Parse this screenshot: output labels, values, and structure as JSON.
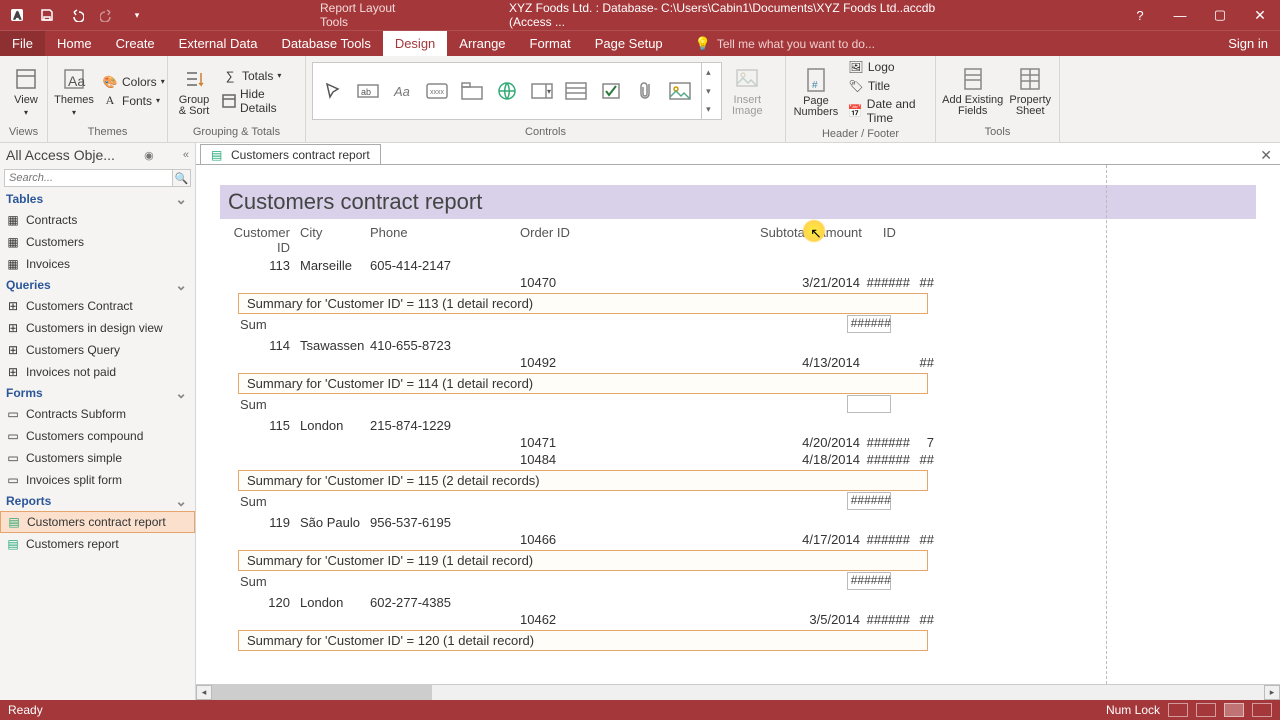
{
  "titlebar": {
    "tools_label": "Report Layout Tools",
    "doc_title": "XYZ Foods Ltd. : Database- C:\\Users\\Cabin1\\Documents\\XYZ Foods Ltd..accdb (Access ..."
  },
  "menu": {
    "file": "File",
    "home": "Home",
    "create": "Create",
    "external": "External Data",
    "dbtools": "Database Tools",
    "design": "Design",
    "arrange": "Arrange",
    "format": "Format",
    "pagesetup": "Page Setup",
    "tellme": "Tell me what you want to do...",
    "signin": "Sign in"
  },
  "ribbon": {
    "views_lbl": "Views",
    "view": "View",
    "themes_lbl": "Themes",
    "themes": "Themes",
    "colors": "Colors",
    "fonts": "Fonts",
    "group_sort": "Group\n& Sort",
    "totals": "Totals",
    "hide_details": "Hide Details",
    "grouping_lbl": "Grouping & Totals",
    "controls_lbl": "Controls",
    "insert_image": "Insert\nImage",
    "page_numbers": "Page\nNumbers",
    "logo": "Logo",
    "title": "Title",
    "datetime": "Date and Time",
    "headerfooter_lbl": "Header / Footer",
    "add_existing": "Add Existing\nFields",
    "property_sheet": "Property\nSheet",
    "tools_lbl": "Tools"
  },
  "nav": {
    "header": "All Access Obje...",
    "search_placeholder": "Search...",
    "tables": "Tables",
    "tables_items": [
      "Contracts",
      "Customers",
      "Invoices"
    ],
    "queries": "Queries",
    "queries_items": [
      "Customers Contract",
      "Customers in design view",
      "Customers Query",
      "Invoices not paid"
    ],
    "forms": "Forms",
    "forms_items": [
      "Contracts Subform",
      "Customers compound",
      "Customers simple",
      "Invoices split form"
    ],
    "reports": "Reports",
    "reports_items": [
      "Customers contract report",
      "Customers report"
    ]
  },
  "doc": {
    "tab_title": "Customers contract report"
  },
  "report": {
    "title": "Customers contract report",
    "cols": {
      "custid": "Customer ID",
      "city": "City",
      "phone": "Phone",
      "orderid": "Order ID",
      "date_amount": "Subtotals Amount",
      "amount": "Amount",
      "id": "ID"
    },
    "r113": {
      "cust": "113",
      "city": "Marseille",
      "phone": "605-414-2147",
      "order": "10470",
      "date": "3/21/2014",
      "amount": "######",
      "id": "##",
      "summary": "Summary for 'Customer ID' =  113 (1 detail record)",
      "sum": "Sum",
      "sumval": "######"
    },
    "r114": {
      "cust": "114",
      "city": "Tsawassen",
      "phone": "410-655-8723",
      "order": "10492",
      "date": "4/13/2014",
      "amount": "",
      "id": "##",
      "summary": "Summary for 'Customer ID' =  114 (1 detail record)",
      "sum": "Sum",
      "sumval": ""
    },
    "r115": {
      "cust": "115",
      "city": "London",
      "phone": "215-874-1229",
      "o1": "10471",
      "d1": "4/20/2014",
      "a1": "######",
      "i1": "7",
      "o2": "10484",
      "d2": "4/18/2014",
      "a2": "######",
      "i2": "##",
      "summary": "Summary for 'Customer ID' =  115 (2 detail records)",
      "sum": "Sum",
      "sumval": "######"
    },
    "r119": {
      "cust": "119",
      "city": "São Paulo",
      "phone": "956-537-6195",
      "order": "10466",
      "date": "4/17/2014",
      "amount": "######",
      "id": "##",
      "summary": "Summary for 'Customer ID' =  119 (1 detail record)",
      "sum": "Sum",
      "sumval": "######"
    },
    "r120": {
      "cust": "120",
      "city": "London",
      "phone": "602-277-4385",
      "order": "10462",
      "date": "3/5/2014",
      "amount": "######",
      "id": "##",
      "summary": "Summary for 'Customer ID' =  120 (1 detail record)"
    }
  },
  "status": {
    "ready": "Ready",
    "numlock": "Num Lock"
  }
}
